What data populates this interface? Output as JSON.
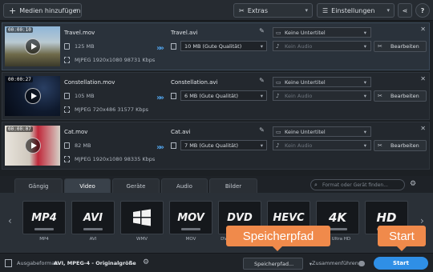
{
  "toolbar": {
    "add_media_label": "Medien hinzufügen",
    "extras_label": "Extras",
    "settings_label": "Einstellungen",
    "help_label": "?"
  },
  "files": [
    {
      "time": "00:00:10",
      "source_name": "Travel.mov",
      "source_size": "125 MB",
      "source_info": "MJPEG 1920x1080 98731 Kbps",
      "output_name": "Travel.avi",
      "output_size": "10 MB (Gute Qualität)",
      "subtitle": "Keine Untertitel",
      "audio": "Kein Audio",
      "edit_label": "Bearbeiten"
    },
    {
      "time": "00:00:27",
      "source_name": "Constellation.mov",
      "source_size": "105 MB",
      "source_info": "MJPEG 720x486 31577 Kbps",
      "output_name": "Constellation.avi",
      "output_size": "6 MB (Gute Qualität)",
      "subtitle": "Keine Untertitel",
      "audio": "Kein Audio",
      "edit_label": "Bearbeiten"
    },
    {
      "time": "00:00:07",
      "source_name": "Cat.mov",
      "source_size": "82 MB",
      "source_info": "MJPEG 1920x1080 98335 Kbps",
      "output_name": "Cat.avi",
      "output_size": "7 MB (Gute Qualität)",
      "subtitle": "Keine Untertitel",
      "audio": "Kein Audio",
      "edit_label": "Bearbeiten"
    }
  ],
  "tabs": [
    "Gängig",
    "Video",
    "Geräte",
    "Audio",
    "Bilder"
  ],
  "active_tab": "Video",
  "search": {
    "placeholder": "Format oder Gerät finden..."
  },
  "formats": [
    {
      "logo": "MP4",
      "name": "MP4"
    },
    {
      "logo": "AVI",
      "name": "AVI"
    },
    {
      "logo": "",
      "name": "WMV"
    },
    {
      "logo": "MOV",
      "name": "MOV"
    },
    {
      "logo": "DVD",
      "name": "DVD-kompatibles Video"
    },
    {
      "logo": "HEVC",
      "name": ""
    },
    {
      "logo": "4K",
      "name": "4K Ultra HD"
    },
    {
      "logo": "HD",
      "name": ""
    }
  ],
  "status": {
    "format_label": "Ausgabeformat:",
    "format_value": "AVI, MPEG-4 - Originalgröße",
    "save_path_label": "Speicherpfad...",
    "merge_label": "Zusammenführen:",
    "start_label": "Start"
  },
  "callouts": {
    "save_path": "Speicherpfad",
    "start": "Start"
  },
  "colors": {
    "accent": "#2f8fe6",
    "callout": "#f08a4b"
  }
}
